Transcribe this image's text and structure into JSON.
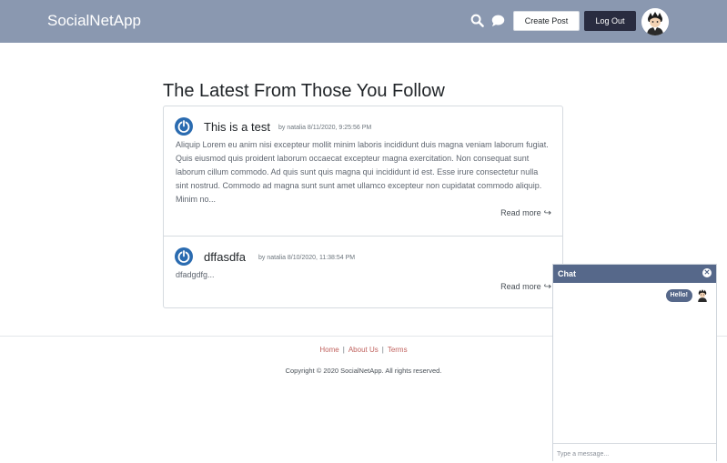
{
  "header": {
    "brand": "SocialNetApp",
    "create_post_label": "Create Post",
    "logout_label": "Log Out",
    "icons": [
      "search-icon",
      "chat-icon",
      "avatar"
    ]
  },
  "feed": {
    "title": "The Latest From Those You Follow",
    "posts": [
      {
        "title": "This is a test",
        "meta": "by natalia 8/11/2020, 9:25:56 PM",
        "body": "Aliquip Lorem eu anim nisi excepteur mollit minim laboris incididunt duis magna veniam laborum fugiat. Quis eiusmod quis proident laborum occaecat excepteur magna exercitation. Non consequat sunt laborum cillum commodo. Ad quis sunt quis magna qui incididunt id est. Esse irure consectetur nulla sint nostrud. Commodo ad magna sunt sunt amet ullamco excepteur non cupidatat commodo aliquip. Minim no...",
        "readmore": "Read more"
      },
      {
        "title": "dffasdfa",
        "meta": "by natalia 8/10/2020, 11:38:54 PM",
        "body": "dfadgdfg...",
        "readmore": "Read more"
      }
    ]
  },
  "footer": {
    "links": [
      "Home",
      "About Us",
      "Terms"
    ],
    "separator": "|",
    "copyright": "Copyright © 2020 SocialNetApp. All rights reserved."
  },
  "chat": {
    "title": "Chat",
    "close_icon": "close-icon",
    "messages": [
      {
        "text": "Hello!"
      }
    ],
    "input_placeholder": "Type a message..."
  },
  "colors": {
    "topbar": "#8a98b0",
    "logout": "#292c40",
    "chat_header": "#56688a",
    "footer_link": "#c0625e"
  }
}
